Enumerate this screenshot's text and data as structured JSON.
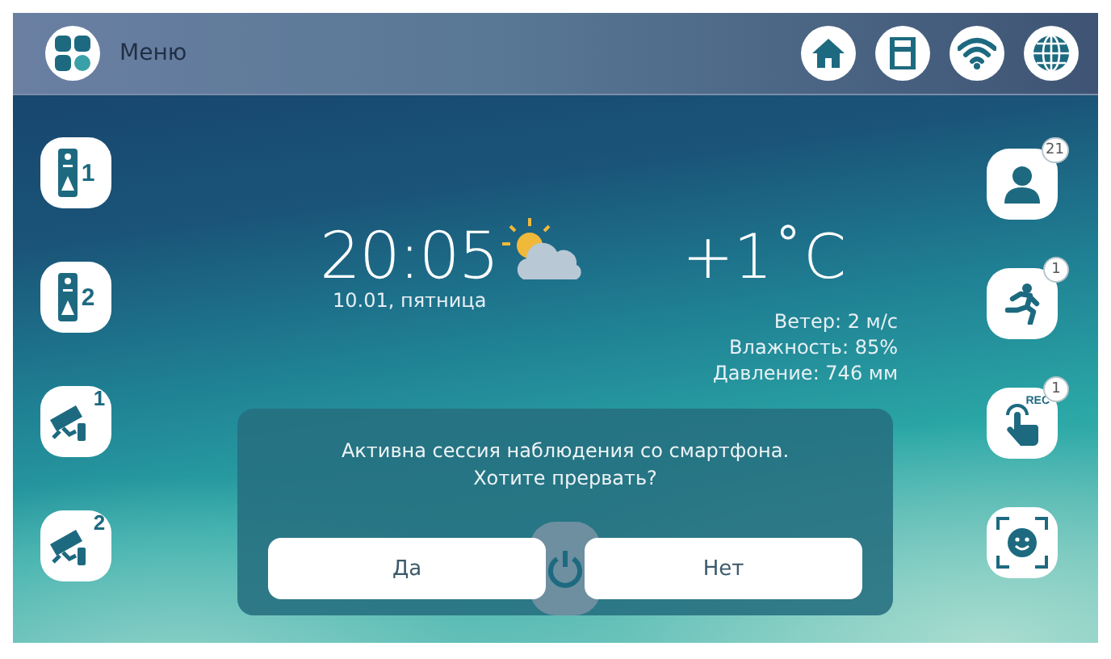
{
  "top_bar": {
    "menu_label": "Меню"
  },
  "left_buttons": [
    {
      "kind": "intercom",
      "number": "1"
    },
    {
      "kind": "intercom",
      "number": "2"
    },
    {
      "kind": "camera",
      "number": "1"
    },
    {
      "kind": "camera",
      "number": "2"
    }
  ],
  "right_buttons": [
    {
      "kind": "contacts",
      "badge": "21"
    },
    {
      "kind": "motion",
      "badge": "1"
    },
    {
      "kind": "record",
      "badge": "1",
      "tag": "REC"
    },
    {
      "kind": "face"
    }
  ],
  "clock": {
    "time": "20:05",
    "date": "10.01, пятница"
  },
  "weather": {
    "temperature": "+1˚C",
    "details": [
      "Ветер: 2 м/с",
      "Влажность: 85%",
      "Давление: 746 мм"
    ]
  },
  "dialog": {
    "message": [
      "Активна сессия наблюдения со смартфона.",
      "Хотите прервать?"
    ],
    "buttons": [
      "Да",
      "Нет"
    ]
  }
}
